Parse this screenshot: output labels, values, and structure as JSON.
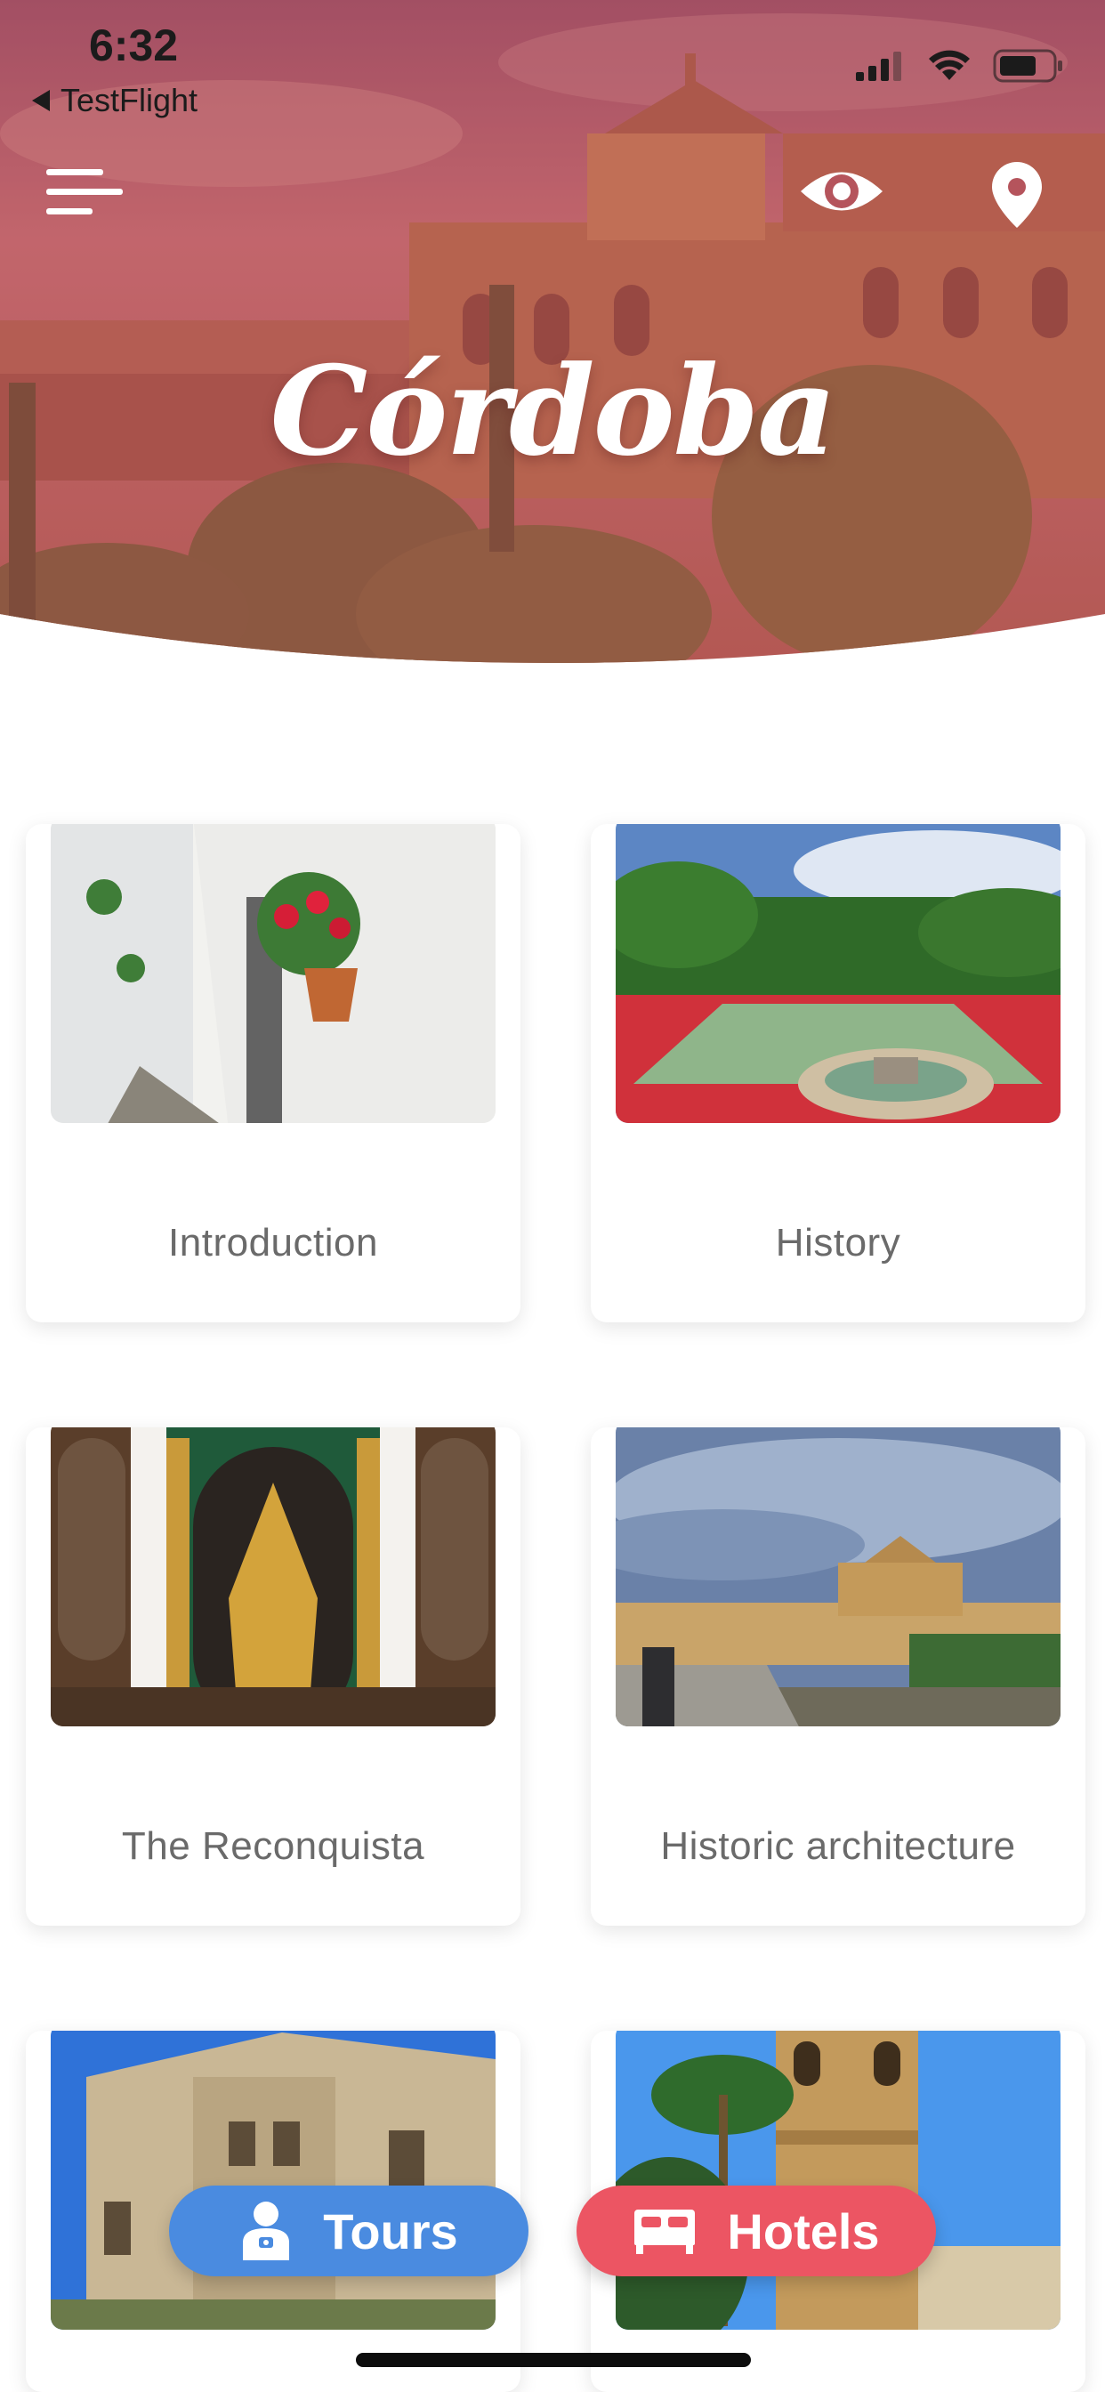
{
  "status_bar": {
    "time": "6:32",
    "back_app": "TestFlight"
  },
  "header": {
    "city_title": "Córdoba",
    "menu_icon": "hamburger-menu-icon",
    "view_icon": "eye-icon",
    "map_icon": "map-pin-icon",
    "overlay_color": "#b5545c"
  },
  "cards": [
    {
      "label": "Introduction",
      "image": "whitewashed-street-with-flower-pot"
    },
    {
      "label": "History",
      "image": "alcazar-gardens-fountain"
    },
    {
      "label": "The Reconquista",
      "image": "ornate-golden-altar"
    },
    {
      "label": "Historic architecture",
      "image": "roman-bridge-and-mosque-skyline"
    },
    {
      "label": "",
      "image": "baroque-church-facade"
    },
    {
      "label": "",
      "image": "bell-tower-with-palm-trees"
    }
  ],
  "bottom_actions": {
    "tours_label": "Tours",
    "hotels_label": "Hotels",
    "tours_color": "#4a8be0",
    "hotels_color": "#ec5563"
  }
}
